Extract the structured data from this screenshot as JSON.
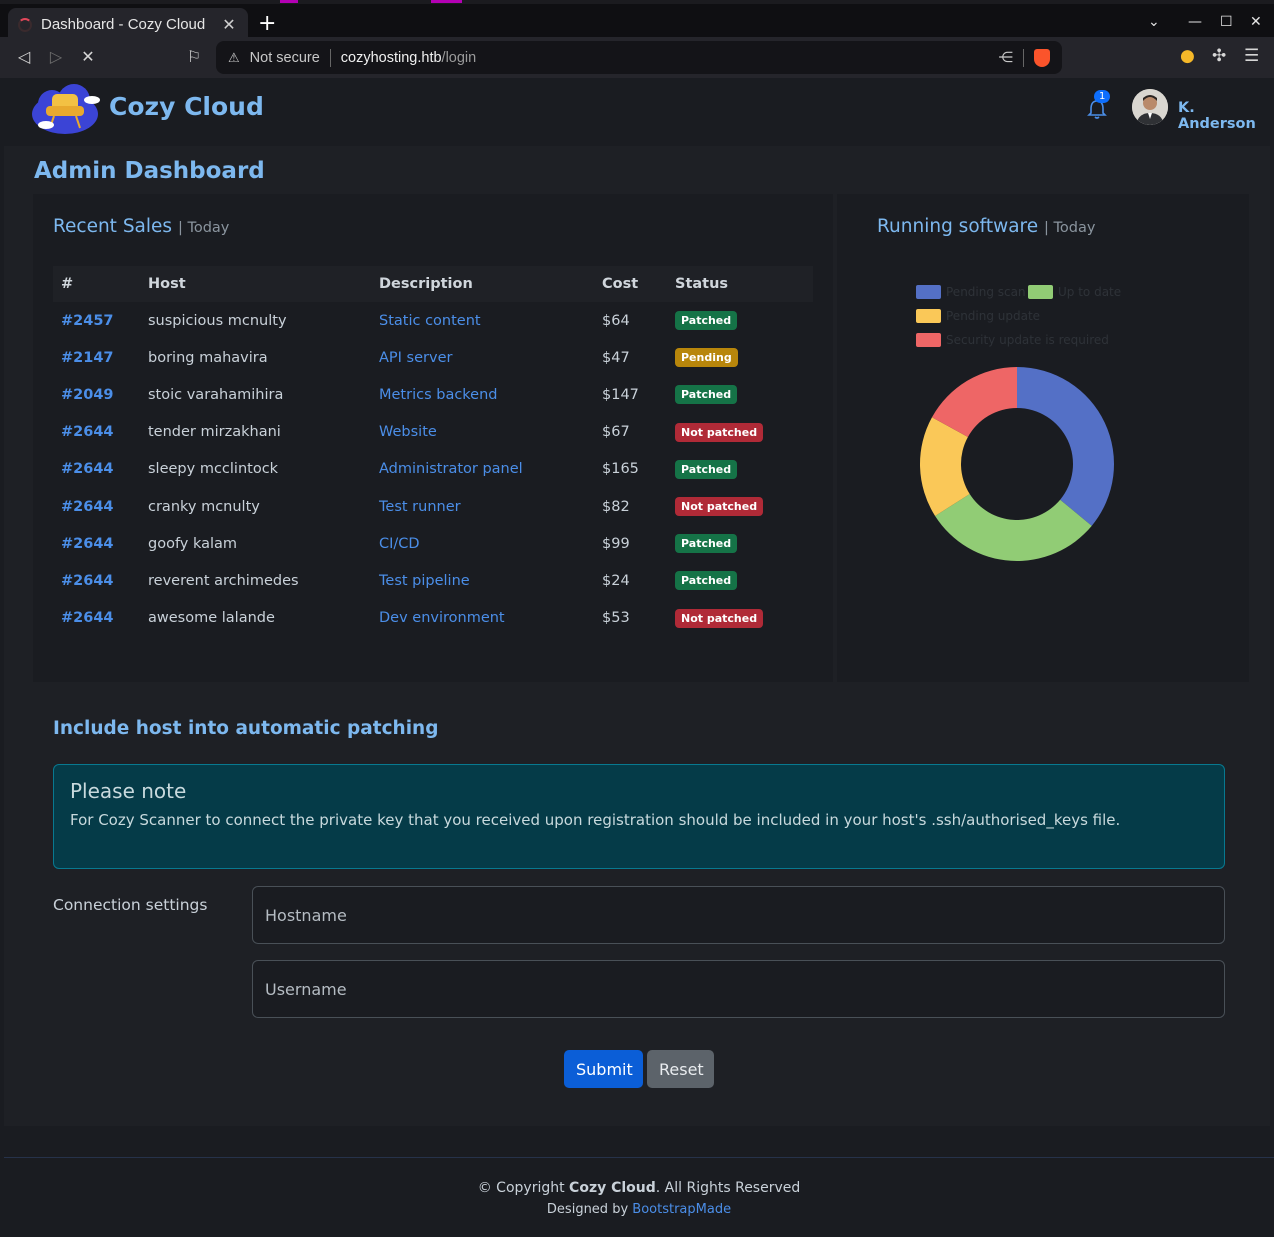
{
  "browser": {
    "tab_title": "Dashboard - Cozy Cloud",
    "tab_close": "✕",
    "new_tab": "+",
    "url_warning": "Not secure",
    "url_host": "cozyhosting.htb",
    "url_path": "/login"
  },
  "header": {
    "brand": "Cozy Cloud",
    "notification_count": "1",
    "user_name": "K. Anderson"
  },
  "page_title": "Admin Dashboard",
  "recent_sales": {
    "title": "Recent Sales",
    "subtitle": "| Today",
    "columns": [
      "#",
      "Host",
      "Description",
      "Cost",
      "Status"
    ],
    "rows": [
      {
        "id": "#2457",
        "host": "suspicious mcnulty",
        "desc": "Static content",
        "cost": "$64",
        "status": "Patched"
      },
      {
        "id": "#2147",
        "host": "boring mahavira",
        "desc": "API server",
        "cost": "$47",
        "status": "Pending"
      },
      {
        "id": "#2049",
        "host": "stoic varahamihira",
        "desc": "Metrics backend",
        "cost": "$147",
        "status": "Patched"
      },
      {
        "id": "#2644",
        "host": "tender mirzakhani",
        "desc": "Website",
        "cost": "$67",
        "status": "Not patched"
      },
      {
        "id": "#2644",
        "host": "sleepy mcclintock",
        "desc": "Administrator panel",
        "cost": "$165",
        "status": "Patched"
      },
      {
        "id": "#2644",
        "host": "cranky mcnulty",
        "desc": "Test runner",
        "cost": "$82",
        "status": "Not patched"
      },
      {
        "id": "#2644",
        "host": "goofy kalam",
        "desc": "CI/CD",
        "cost": "$99",
        "status": "Patched"
      },
      {
        "id": "#2644",
        "host": "reverent archimedes",
        "desc": "Test pipeline",
        "cost": "$24",
        "status": "Patched"
      },
      {
        "id": "#2644",
        "host": "awesome lalande",
        "desc": "Dev environment",
        "cost": "$53",
        "status": "Not patched"
      }
    ]
  },
  "running_software": {
    "title": "Running software",
    "subtitle": "| Today"
  },
  "chart_data": {
    "type": "pie",
    "donut": true,
    "categories": [
      "Pending scan",
      "Up to date",
      "Pending update",
      "Security update is required"
    ],
    "values": [
      36,
      30,
      17,
      17
    ],
    "colors": [
      "#5470c6",
      "#91cc75",
      "#fac858",
      "#ee6666"
    ],
    "legend": "top"
  },
  "patching": {
    "title": "Include host into automatic patching",
    "note_heading": "Please note",
    "note_text": "For Cozy Scanner to connect the private key that you received upon registration should be included in your host's .ssh/authorised_keys file.",
    "connection_label": "Connection settings",
    "hostname_placeholder": "Hostname",
    "username_placeholder": "Username",
    "submit_label": "Submit",
    "reset_label": "Reset"
  },
  "footer": {
    "copyright_prefix": "© Copyright",
    "brand": "Cozy Cloud",
    "copyright_suffix": ". All Rights Reserved",
    "designed_by": "Designed by",
    "designer": "BootstrapMade"
  }
}
